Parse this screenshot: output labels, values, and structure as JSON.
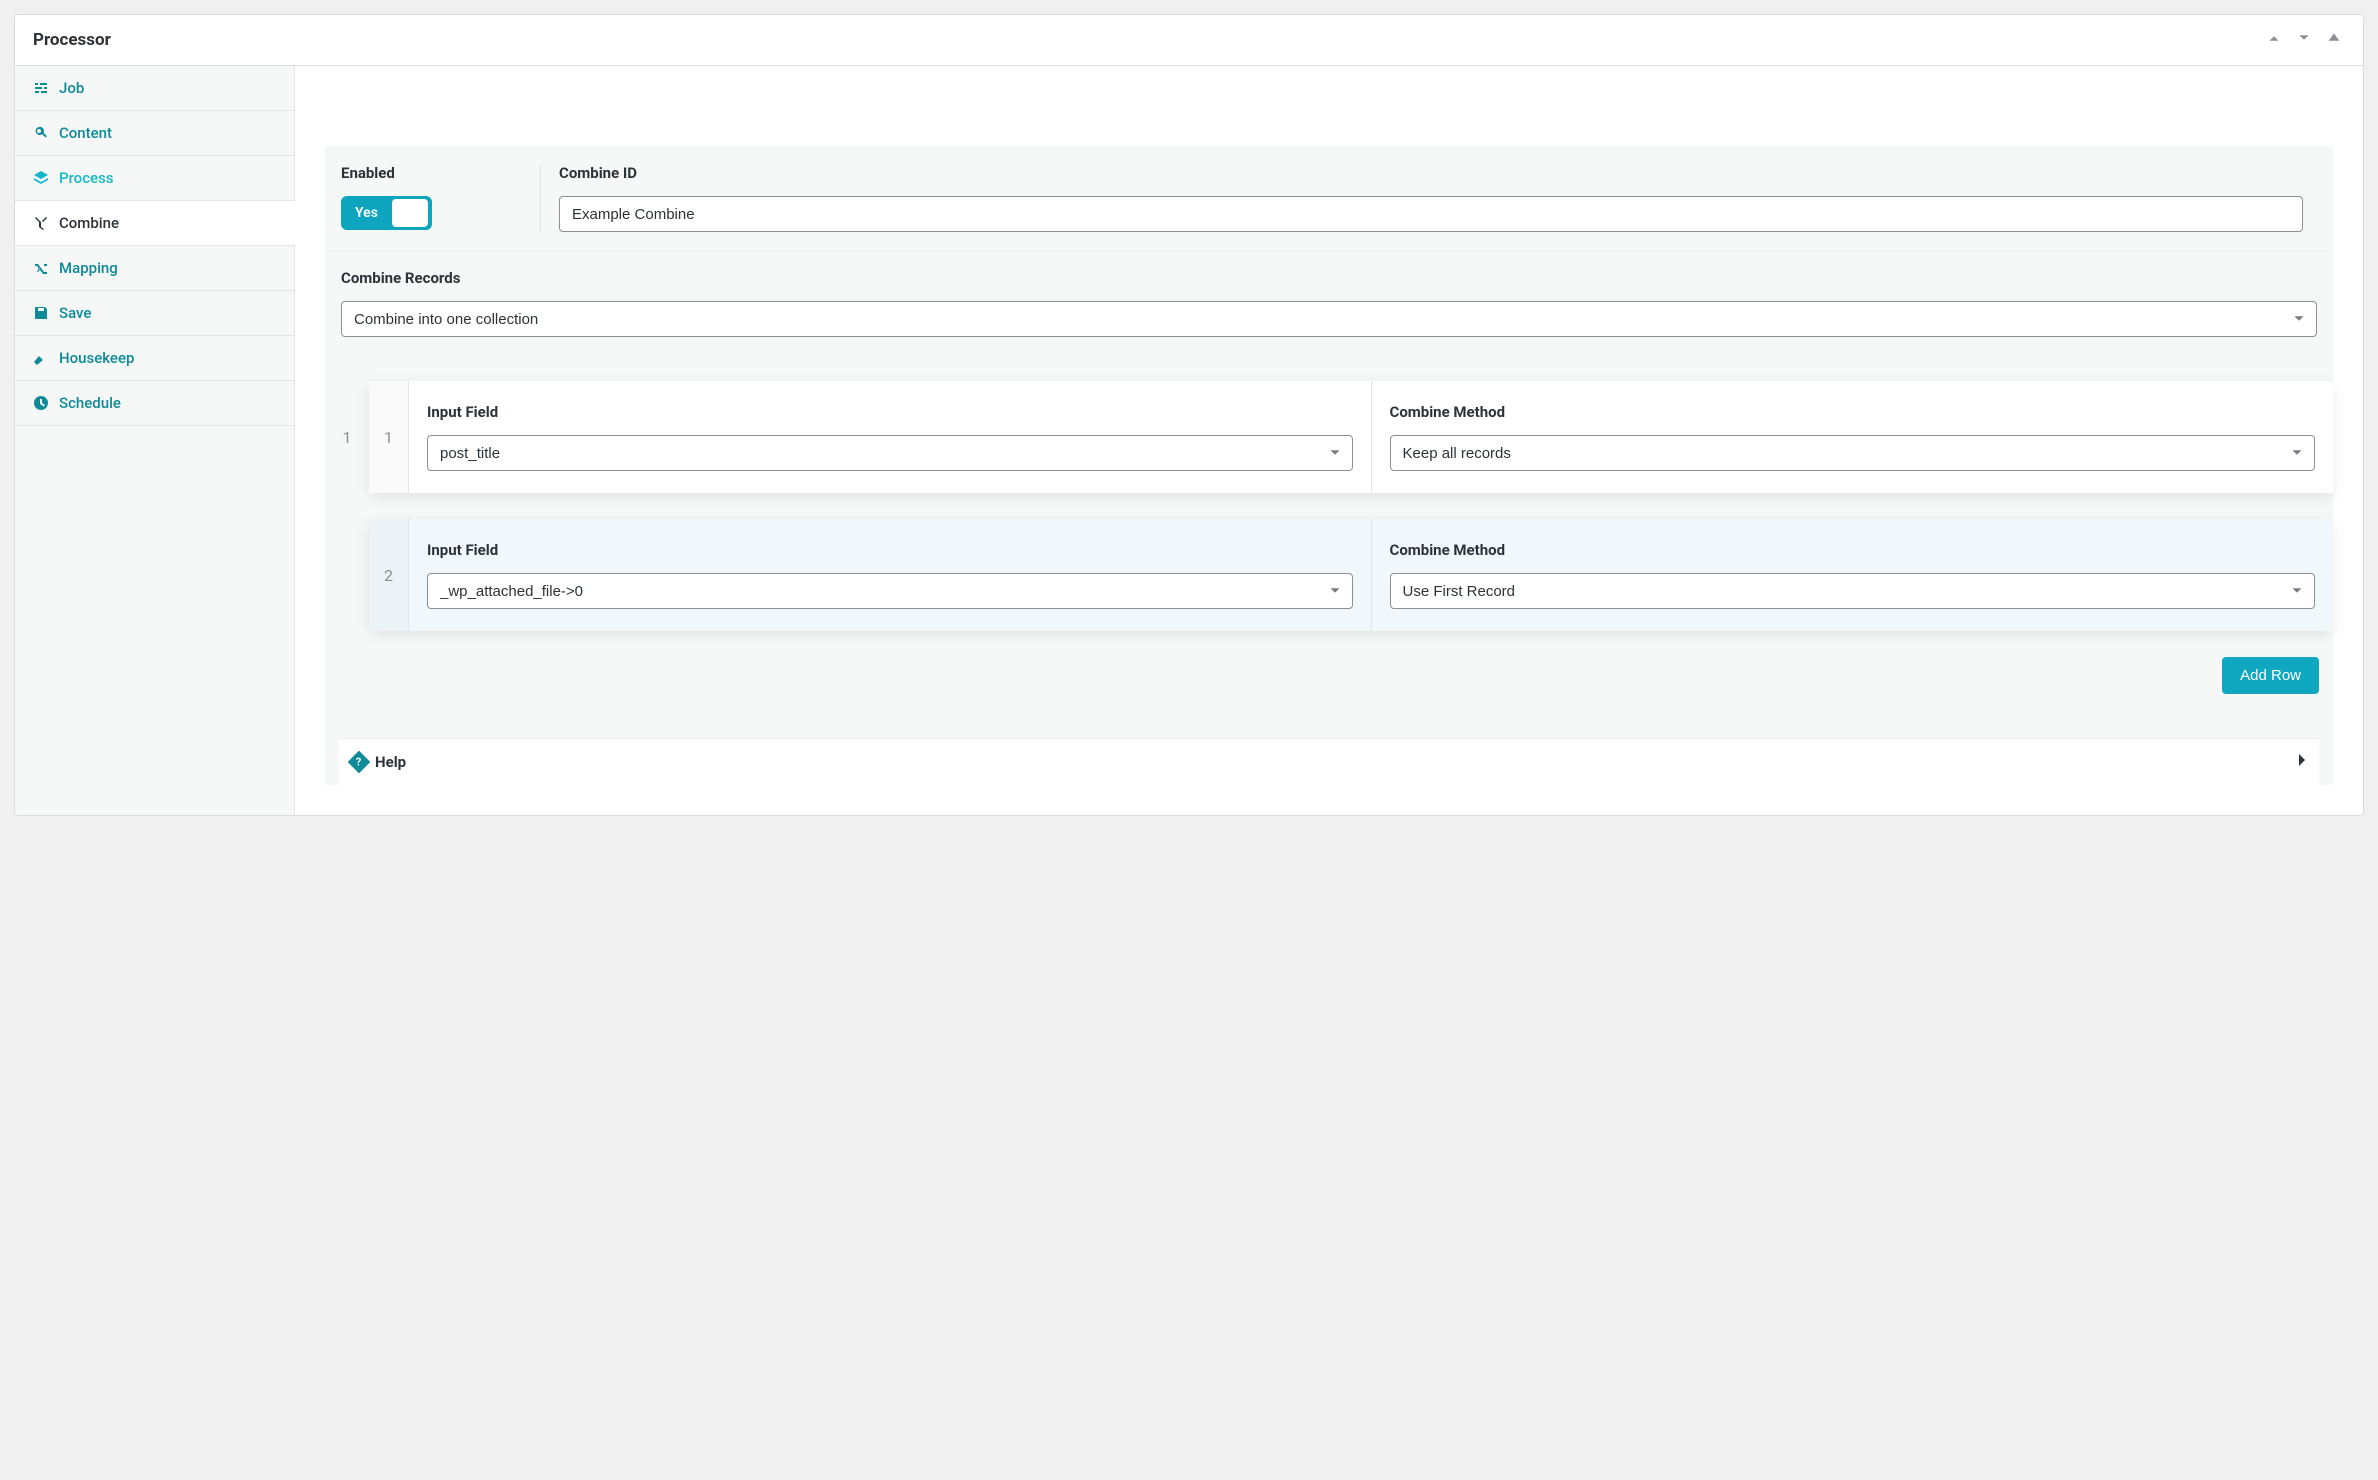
{
  "panel": {
    "title": "Processor"
  },
  "sidebar": {
    "items": [
      {
        "label": "Job"
      },
      {
        "label": "Content"
      },
      {
        "label": "Process"
      },
      {
        "label": "Combine"
      },
      {
        "label": "Mapping"
      },
      {
        "label": "Save"
      },
      {
        "label": "Housekeep"
      },
      {
        "label": "Schedule"
      }
    ]
  },
  "form": {
    "enabled_label": "Enabled",
    "enabled_value": "Yes",
    "combine_id_label": "Combine ID",
    "combine_id_value": "Example Combine",
    "combine_records_label": "Combine Records",
    "combine_records_value": "Combine into one collection"
  },
  "row_headers": {
    "input_field": "Input Field",
    "combine_method": "Combine Method"
  },
  "rows": [
    {
      "index": "1",
      "input_field": "post_title",
      "combine_method": "Keep all records"
    },
    {
      "index": "2",
      "input_field": "_wp_attached_file->0",
      "combine_method": "Use First Record"
    }
  ],
  "buttons": {
    "add_row": "Add Row"
  },
  "help": {
    "label": "Help"
  }
}
